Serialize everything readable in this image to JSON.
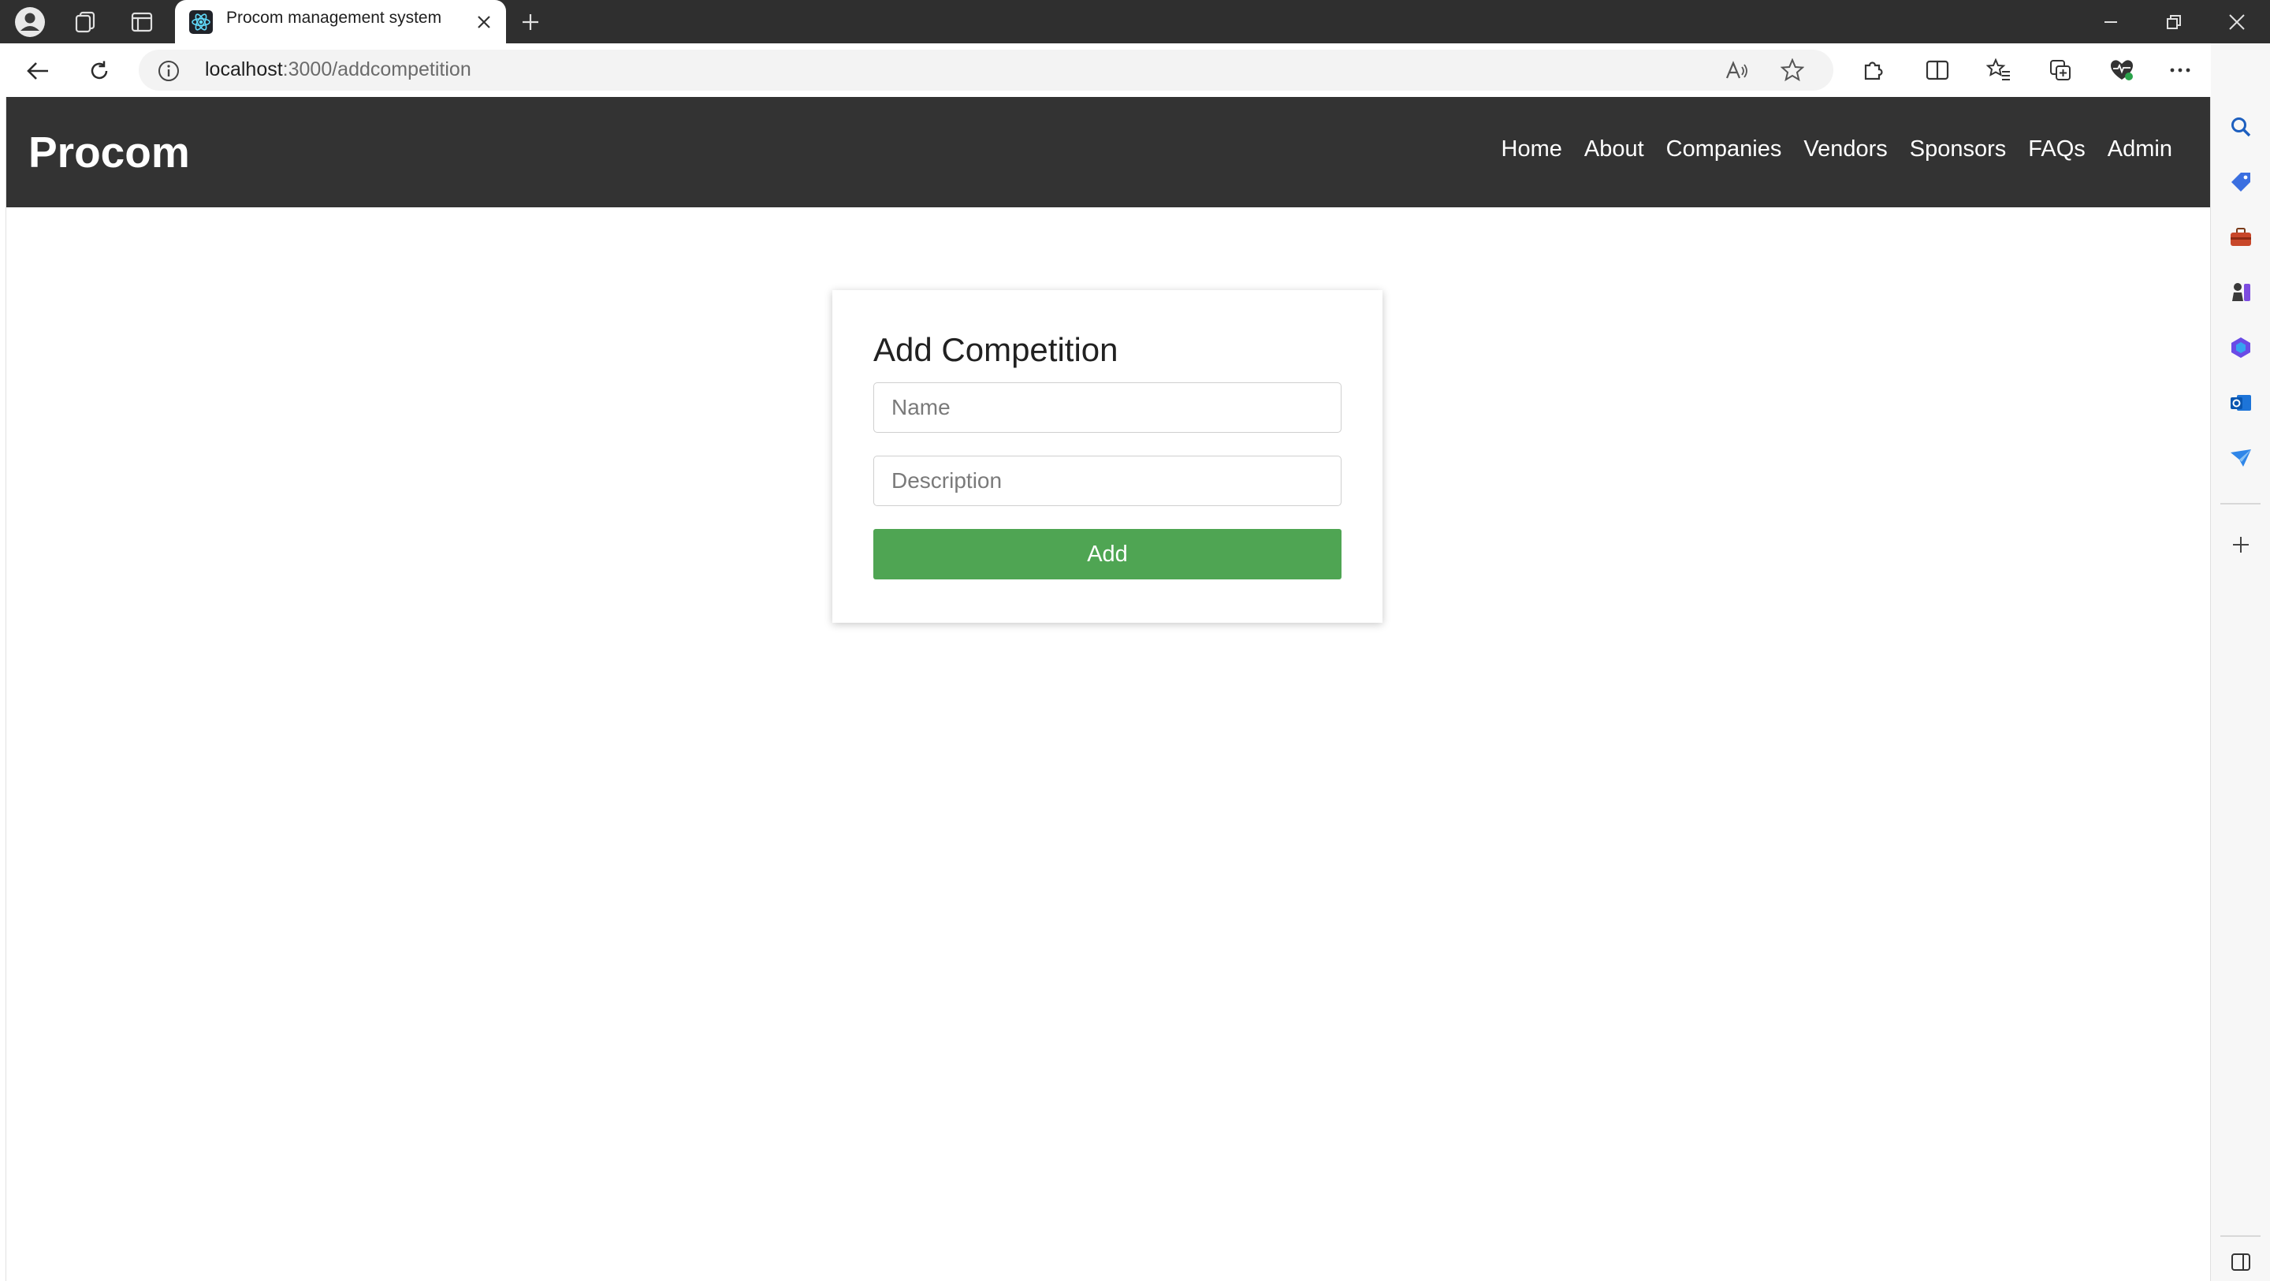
{
  "browser": {
    "tab_title": "Procom management system",
    "url_host": "localhost",
    "url_path": ":3000/addcompetition",
    "accent": "#2f2f2f"
  },
  "navbar": {
    "brand": "Procom",
    "background": "#333333",
    "links": [
      "Home",
      "About",
      "Companies",
      "Vendors",
      "Sponsors",
      "FAQs",
      "Admin"
    ]
  },
  "form": {
    "title": "Add Competition",
    "name_placeholder": "Name",
    "description_placeholder": "Description",
    "submit_label": "Add",
    "button_color": "#4fa553"
  },
  "icons": {
    "tabstrip": [
      "profile-icon",
      "workspaces-icon",
      "tab-actions-icon",
      "react-favicon-icon",
      "tab-close-icon",
      "new-tab-icon",
      "minimize-icon",
      "restore-icon",
      "window-close-icon"
    ],
    "toolbar": [
      "back-icon",
      "refresh-icon",
      "site-info-icon",
      "read-aloud-icon",
      "favorite-star-icon",
      "extensions-icon",
      "split-screen-icon",
      "favorites-icon",
      "collections-icon",
      "browser-essentials-icon",
      "more-icon",
      "copilot-icon"
    ],
    "sidebar": [
      "search-icon",
      "shopping-tag-icon",
      "tools-briefcase-icon",
      "games-icon",
      "microsoft365-icon",
      "outlook-icon",
      "drop-icon",
      "add-icon",
      "sidebar-toggle-icon"
    ]
  }
}
